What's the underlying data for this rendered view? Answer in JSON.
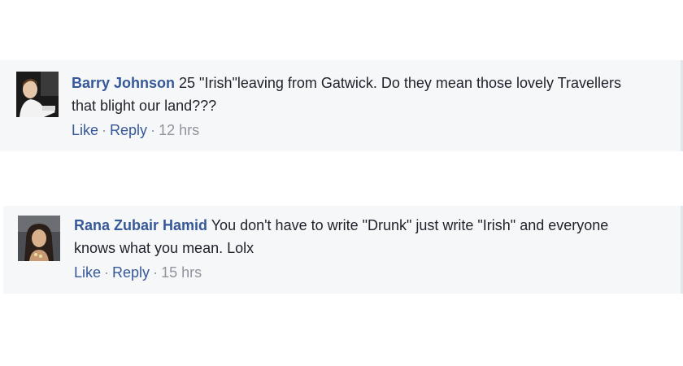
{
  "comments": [
    {
      "author": "Barry Johnson",
      "text": " 25 \"Irish\"leaving from Gatwick. Do they mean those lovely Travellers that blight our land???",
      "like_label": "Like",
      "reply_label": "Reply",
      "separator": "·",
      "timestamp": "12 hrs",
      "avatar_icon": "profile-photo-icon"
    },
    {
      "author": "Rana Zubair Hamid",
      "text": " You don't have to write \"Drunk\" just write \"Irish\" and everyone knows what you mean. Lolx",
      "like_label": "Like",
      "reply_label": "Reply",
      "separator": "·",
      "timestamp": "15 hrs",
      "avatar_icon": "profile-photo-icon"
    }
  ],
  "colors": {
    "background": "#ffffff",
    "comment_bg": "#f6f7f9",
    "link": "#365899",
    "body_text": "#1d2129",
    "meta": "#90949c"
  }
}
